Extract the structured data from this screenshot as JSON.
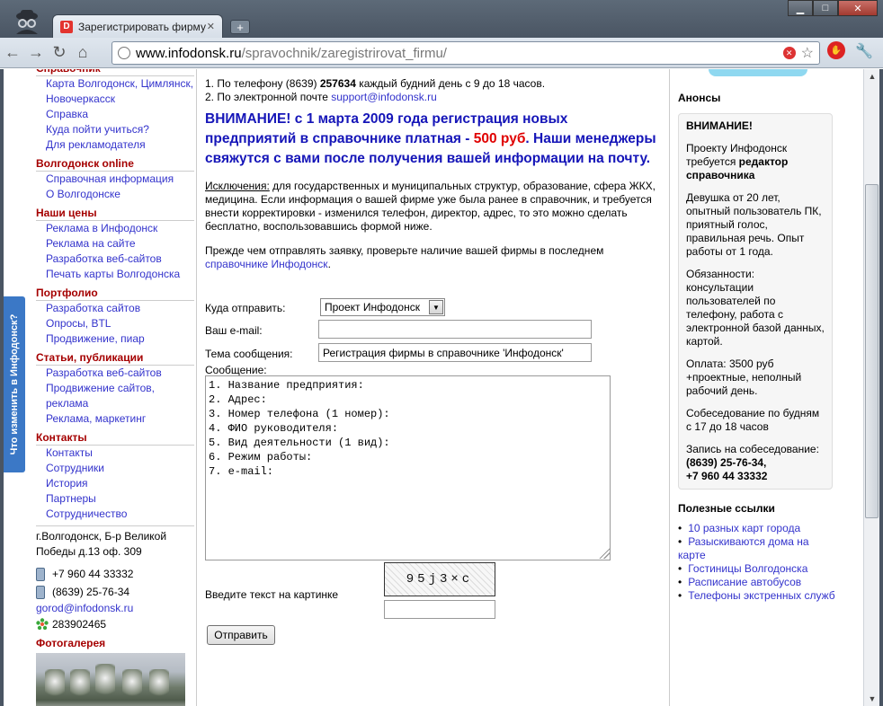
{
  "browser": {
    "tab_title": "Зарегистрировать фирму",
    "url_host": "www.infodonsk.ru",
    "url_path": "/spravochnik/zaregistrirovat_firmu/",
    "new_tab": "+"
  },
  "feedback_tab": "Что изменить в Инфодонск?",
  "left": {
    "sections": [
      {
        "title": "Справочник",
        "links": [
          "Карта Волгодонск, Цимлянск, Новочеркасск",
          "Справка",
          "Куда пойти учиться?",
          "Для рекламодателя"
        ]
      },
      {
        "title": "Волгодонск online",
        "links": [
          "Справочная информация",
          "О Волгодонске"
        ]
      },
      {
        "title": "Наши цены",
        "links": [
          "Реклама в Инфодонск",
          "Реклама на сайте",
          "Разработка веб-сайтов",
          "Печать карты Волгодонска"
        ]
      },
      {
        "title": "Портфолио",
        "links": [
          "Разработка сайтов",
          "Опросы, BTL",
          "Продвижение, пиар"
        ]
      },
      {
        "title": "Статьи, публикации",
        "links": [
          "Разработка веб-сайтов",
          "Продвижение сайтов, реклама",
          "Реклама, маркетинг"
        ]
      },
      {
        "title": "Контакты",
        "links": [
          "Контакты",
          "Сотрудники",
          "История",
          "Партнеры",
          "Сотрудничество"
        ]
      }
    ],
    "address": "г.Волгодонск, Б-р Великой Победы д.13 оф. 309",
    "mobile": "+7 960 44 33332",
    "phone": "(8639) 25-76-34",
    "email": "gorod@infodonsk.ru",
    "icq": "283902465",
    "photo_title": "Фотогалерея"
  },
  "center": {
    "line1_pre": "1. По телефону (8639) ",
    "line1_bold": "257634",
    "line1_post": " каждый будний день с 9 до 18 часов.",
    "line2_pre": "2. По электронной почте ",
    "line2_link": "support@infodonsk.ru",
    "warning_pre": "ВНИМАНИЕ! с 1 марта 2009 года регистрация новых предприятий в справочнике платная - ",
    "warning_price": "500 руб",
    "warning_post": ". Наши менеджеры свяжутся с вами после получения вашей информации на почту.",
    "exceptions_label": "Исключения:",
    "exceptions_text": " для государственных и муниципальных структур, образование, сфера ЖКХ, медицина. Если информация о вашей фирме уже была ранее в справочник, и требуется внести корректировки - изменился телефон, директор, адрес, то это можно сделать бесплатно, воспользовавшись формой ниже.",
    "check_pre": "Прежде чем отправлять заявку, проверьте наличие вашей фирмы в последнем ",
    "check_link": "справочнике Инфодонск",
    "check_post": "."
  },
  "form": {
    "to_label": "Куда отправить:",
    "to_value": "Проект Инфодонск",
    "email_label": "Ваш e-mail:",
    "email_value": "",
    "subject_label": "Тема сообщения:",
    "subject_value": "Регистрация фирмы в справочнике 'Инфодонск'",
    "message_label": "Сообщение:",
    "message_value": "1. Название предприятия:\n2. Адрес:\n3. Номер телефона (1 номер):\n4. ФИО руководителя:\n5. Вид деятельности (1 вид):\n6. Режим работы:\n7. e-mail:",
    "captcha_label": "Введите текст на картинке",
    "captcha_text": "95j3×c",
    "submit_label": "Отправить"
  },
  "right": {
    "announce_title": "Анонсы",
    "announce_head": "ВНИМАНИЕ!",
    "p1_pre": "Проекту Инфодонск требуется ",
    "p1_bold": "редактор справочника",
    "p2": "Девушка от 20 лет, опытный пользователь ПК, приятный голос, правильная речь. Опыт работы от 1 года.",
    "p3": "Обязанности: консультации пользователей по телефону, работа с электронной базой данных, картой.",
    "p4": "Оплата: 3500 руб +проектные, неполный рабочий день.",
    "p5": "Собеседование по будням с 17 до 18 часов",
    "p6_pre": "Запись на собеседование:",
    "p6_bold": "(8639) 25-76-34,\n+7 960 44 33332",
    "useful_title": "Полезные ссылки",
    "useful_links": [
      "10 разных карт города",
      "Разыскиваются дома на карте",
      "Гостиницы Волгодонска",
      "Расписание автобусов",
      "Телефоны экстренных служб"
    ]
  }
}
